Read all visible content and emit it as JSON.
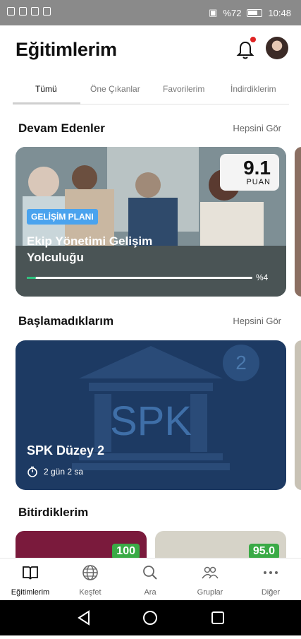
{
  "status_bar": {
    "battery_text": "%72",
    "time": "10:48"
  },
  "header": {
    "title": "Eğitimlerim"
  },
  "tabs": [
    {
      "label": "Tümü",
      "active": true
    },
    {
      "label": "Öne Çıkanlar",
      "active": false
    },
    {
      "label": "Favorilerim",
      "active": false
    },
    {
      "label": "İndirdiklerim",
      "active": false
    }
  ],
  "sections": {
    "continuing": {
      "title": "Devam Edenler",
      "see_all": "Hepsini Gör"
    },
    "not_started": {
      "title": "Başlamadıklarım",
      "see_all": "Hepsini Gör"
    },
    "finished": {
      "title": "Bitirdiklerim"
    }
  },
  "continue_card": {
    "score": "9.1",
    "score_label": "PUAN",
    "badge": "GELİŞİM PLANI",
    "title": "Ekip Yönetimi Gelişim Yolculuğu",
    "progress_percent": 4,
    "progress_text": "%4"
  },
  "not_started_card": {
    "title": "SPK Düzey 2",
    "duration": "2 gün 2 sa",
    "level_number": "2",
    "image_text": "SPK"
  },
  "finished_cards": [
    {
      "score": "100"
    },
    {
      "score": "95.0"
    }
  ],
  "bottom_nav": [
    {
      "label": "Eğitimlerim",
      "icon": "book-icon",
      "active": true
    },
    {
      "label": "Keşfet",
      "icon": "globe-icon",
      "active": false
    },
    {
      "label": "Ara",
      "icon": "search-icon",
      "active": false
    },
    {
      "label": "Gruplar",
      "icon": "group-icon",
      "active": false
    },
    {
      "label": "Diğer",
      "icon": "more-icon",
      "active": false
    }
  ],
  "colors": {
    "accent_badge": "#4aa3ee",
    "progress": "#2ec27e",
    "spk_card": "#1d3a63",
    "score_green": "#3aaa46"
  }
}
